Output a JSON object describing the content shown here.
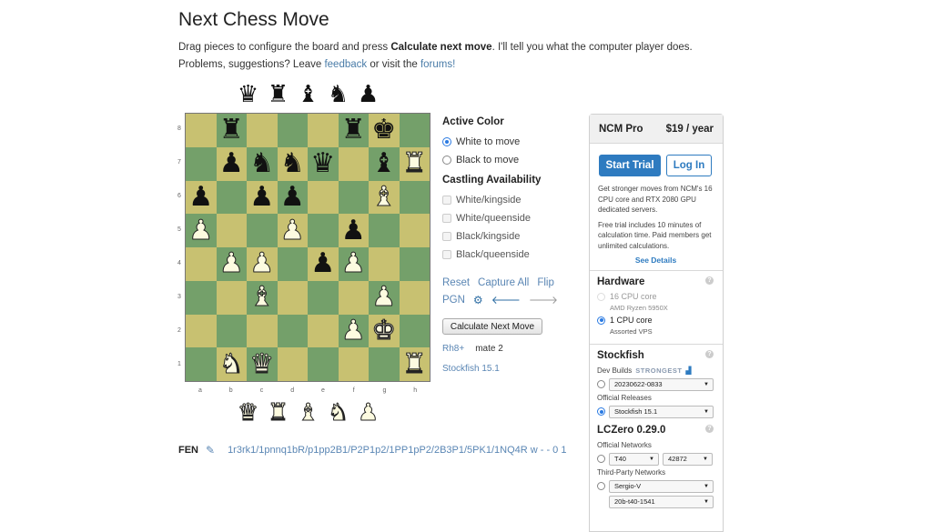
{
  "page": {
    "title": "Next Chess Move",
    "intro_prefix": "Drag pieces to configure the board and press ",
    "intro_bold": "Calculate next move",
    "intro_mid": ". I'll tell you what the computer player does. Problems, suggestions? Leave ",
    "feedback_link": "feedback",
    "intro_or": " or visit the ",
    "forums_link": "forums!"
  },
  "spare_pieces": {
    "black": [
      "♛",
      "♜",
      "♝",
      "♞",
      "♟"
    ],
    "white": [
      "♛",
      "♜",
      "♝",
      "♞",
      "♟"
    ]
  },
  "board": {
    "light_color": "#c8c171",
    "dark_color": "#74a06a",
    "ranks": [
      "8",
      "7",
      "6",
      "5",
      "4",
      "3",
      "2",
      "1"
    ],
    "files": [
      "a",
      "b",
      "c",
      "d",
      "e",
      "f",
      "g",
      "h"
    ],
    "position": [
      [
        "",
        "r",
        "",
        "",
        "",
        "r",
        "k",
        ""
      ],
      [
        "",
        "p",
        "n",
        "n",
        "q",
        "",
        "b",
        "R"
      ],
      [
        "p",
        "",
        "p",
        "p",
        "",
        "",
        "B",
        ""
      ],
      [
        "P",
        "",
        "",
        "P",
        "",
        "p",
        "",
        ""
      ],
      [
        "",
        "P",
        "P",
        "",
        "p",
        "P",
        "",
        ""
      ],
      [
        "",
        "",
        "B",
        "",
        "",
        "",
        "P",
        ""
      ],
      [
        "",
        "",
        "",
        "",
        "",
        "P",
        "K",
        ""
      ],
      [
        "",
        "N",
        "Q",
        "",
        "",
        "",
        "",
        "R"
      ]
    ]
  },
  "active_color": {
    "heading": "Active Color",
    "options": [
      {
        "label": "White to move",
        "selected": true
      },
      {
        "label": "Black to move",
        "selected": false
      }
    ]
  },
  "castling": {
    "heading": "Castling Availability",
    "options": [
      {
        "label": "White/kingside",
        "checked": false
      },
      {
        "label": "White/queenside",
        "checked": false
      },
      {
        "label": "Black/kingside",
        "checked": false
      },
      {
        "label": "Black/queenside",
        "checked": false
      }
    ]
  },
  "actions": {
    "reset": "Reset",
    "capture_all": "Capture All",
    "flip": "Flip",
    "pgn": "PGN",
    "gear_icon": "⚙",
    "back_icon": "🡐",
    "forward_icon": "🡒",
    "calculate": "Calculate Next Move"
  },
  "result": {
    "move": "Rh8+",
    "evaluation": "mate 2",
    "engine": "Stockfish 15.1"
  },
  "fen": {
    "label": "FEN",
    "edit_icon": "✎",
    "value": "1r3rk1/1pnnq1bR/p1pp2B1/P2P1p2/1PP1pP2/2B3P1/5PK1/1NQ4R w - - 0 1"
  },
  "pro": {
    "name": "NCM Pro",
    "price": "$19 / year",
    "start_trial": "Start Trial",
    "log_in": "Log In",
    "desc1": "Get stronger moves from NCM's 16 CPU core and RTX 2080 GPU dedicated servers.",
    "desc2": "Free trial includes 10 minutes of calculation time. Paid members get unlimited calculations.",
    "see_details": "See Details",
    "accent": "#2e7bc0"
  },
  "hardware": {
    "heading": "Hardware",
    "help": "?",
    "options": [
      {
        "label": "16 CPU core",
        "sub": "AMD Ryzen 5950X",
        "selected": false,
        "disabled": true
      },
      {
        "label": "1 CPU core",
        "sub": "Assorted VPS",
        "selected": true,
        "disabled": false
      }
    ]
  },
  "stockfish": {
    "heading": "Stockfish",
    "help": "?",
    "dev_builds_label": "Dev Builds",
    "strongest_badge": "STRONGEST",
    "bars_icon": "▟",
    "dev_build_value": "20230622-0833",
    "official_label": "Official Releases",
    "official_value": "Stockfish 15.1",
    "dev_selected": false,
    "official_selected": true
  },
  "lczero": {
    "heading": "LCZero 0.29.0",
    "help": "?",
    "official_label": "Official Networks",
    "official_net": "T40",
    "official_id": "42872",
    "third_label": "Third-Party Networks",
    "third_net": "Sergio-V",
    "third_id": "20b-t40-1541"
  }
}
